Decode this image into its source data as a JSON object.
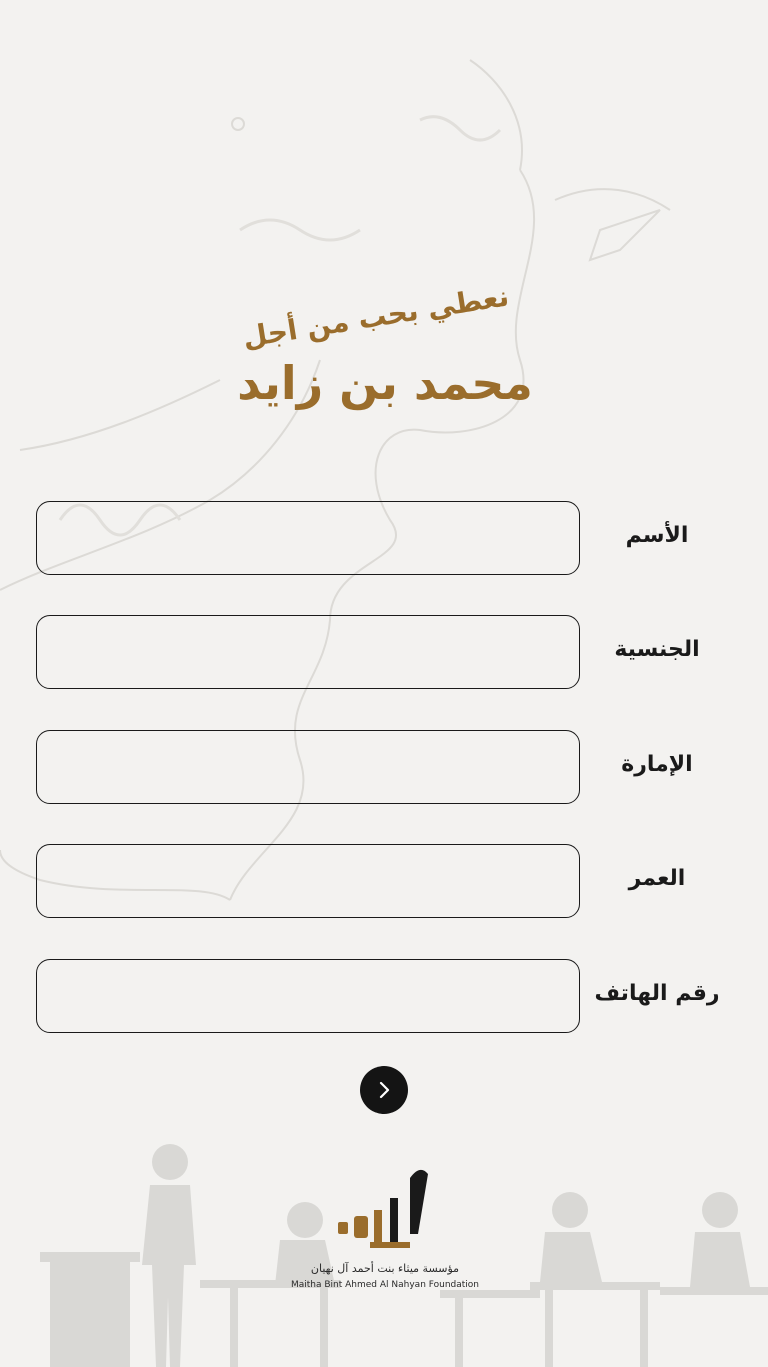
{
  "hero": {
    "subtitle": "نعطي بحب من أجل",
    "title": "محمد بن زايد"
  },
  "form": {
    "fields": [
      {
        "label": "الأسم",
        "value": "",
        "placeholder": ""
      },
      {
        "label": "الجنسية",
        "value": "",
        "placeholder": ""
      },
      {
        "label": "الإمارة",
        "value": "",
        "placeholder": ""
      },
      {
        "label": "العمر",
        "value": "",
        "placeholder": ""
      },
      {
        "label": "رقم الهاتف",
        "value": "",
        "placeholder": ""
      }
    ],
    "next_icon": "chevron-right-icon"
  },
  "footer": {
    "logo_arabic": "مؤسسة ميثاء بنت أحمد آل نهيان",
    "logo_english": "Maitha Bint Ahmed Al Nahyan Foundation"
  },
  "colors": {
    "gold": "#9a6d2c",
    "dark": "#141414",
    "background": "#f3f2f0"
  }
}
